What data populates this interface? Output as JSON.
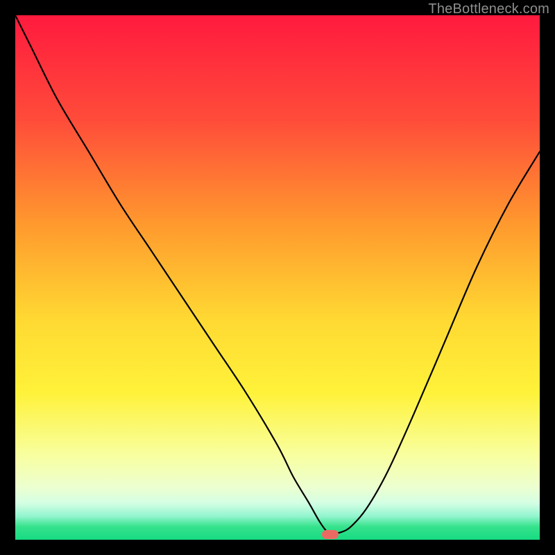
{
  "watermark": "TheBottleneck.com",
  "chart_data": {
    "type": "line",
    "title": "",
    "xlabel": "",
    "ylabel": "",
    "xlim": [
      0,
      100
    ],
    "ylim": [
      0,
      100
    ],
    "gradient_stops": [
      {
        "offset": 0.0,
        "color": "#ff1a3e"
      },
      {
        "offset": 0.2,
        "color": "#ff4c3a"
      },
      {
        "offset": 0.4,
        "color": "#ff9a2e"
      },
      {
        "offset": 0.58,
        "color": "#ffd932"
      },
      {
        "offset": 0.72,
        "color": "#fff23a"
      },
      {
        "offset": 0.84,
        "color": "#f8ffa0"
      },
      {
        "offset": 0.9,
        "color": "#ecffd0"
      },
      {
        "offset": 0.93,
        "color": "#d4ffe4"
      },
      {
        "offset": 0.955,
        "color": "#93f5cf"
      },
      {
        "offset": 0.975,
        "color": "#36e28c"
      },
      {
        "offset": 1.0,
        "color": "#17db82"
      }
    ],
    "series": [
      {
        "name": "bottleneck-curve",
        "x": [
          0,
          3,
          8,
          14,
          20,
          26,
          32,
          38,
          44,
          50,
          53,
          56,
          58,
          59.5,
          60.5,
          62,
          64,
          67,
          71,
          76,
          82,
          88,
          94,
          100
        ],
        "y": [
          100,
          94,
          84,
          74,
          64,
          55,
          46,
          37,
          28,
          18,
          12,
          7,
          3.5,
          1.5,
          1.3,
          1.4,
          2.5,
          6,
          13,
          24,
          38,
          52,
          64,
          74
        ]
      }
    ],
    "marker": {
      "x": 60,
      "y": 1.0,
      "w": 3.2,
      "h": 1.7,
      "color": "#ea6a63"
    }
  }
}
